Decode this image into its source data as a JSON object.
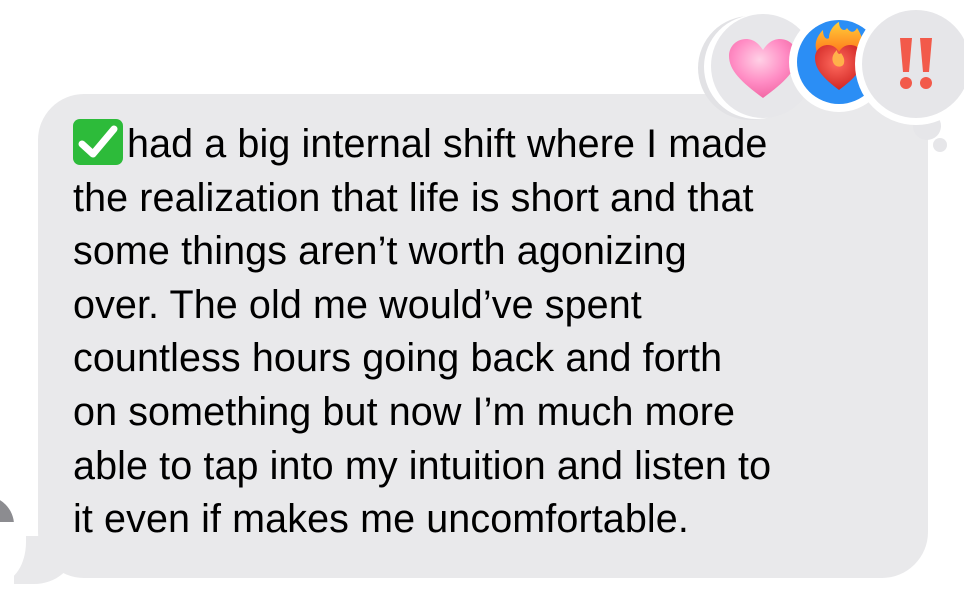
{
  "message": {
    "check_icon": "white-check-mark-icon",
    "text": "had a big internal shift where I made\nthe realization that life is short and that\nsome things aren’t worth agonizing\nover. The old me would’ve spent\ncountless hours going back and forth\non something but now I’m much more\nable to tap into my intuition and listen to\nit even if makes me uncomfortable.",
    "bubble_color": "#e9e9eb"
  },
  "tapbacks": [
    {
      "icon": "pink-heart-icon",
      "selected": false
    },
    {
      "icon": "heart-on-fire-icon",
      "selected": true,
      "highlight_color": "#2b8ef5"
    },
    {
      "icon": "double-exclamation-icon",
      "selected": false
    }
  ],
  "sender": {
    "avatar_icon": "avatar"
  }
}
